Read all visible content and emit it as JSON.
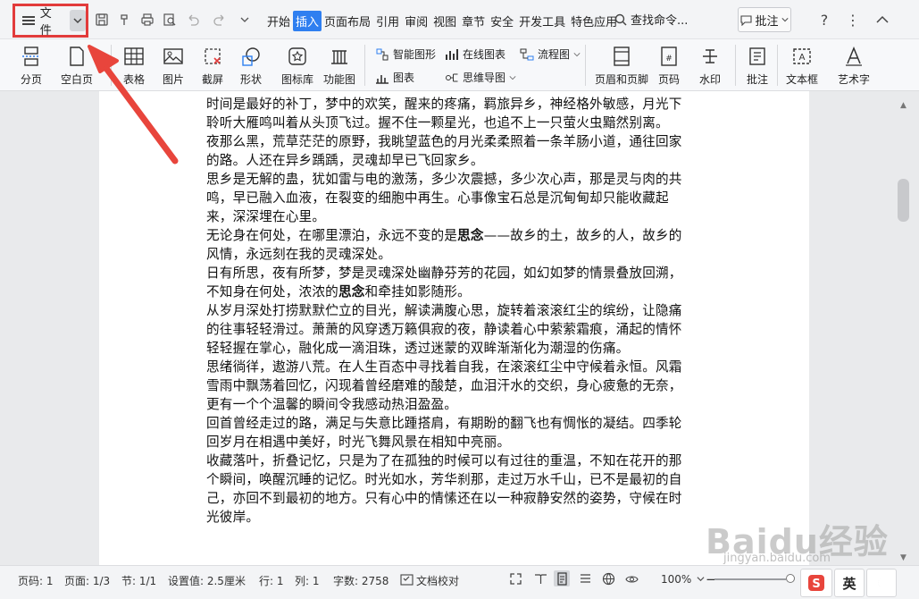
{
  "menubar": {
    "file_label": "文件",
    "tabs": [
      {
        "label": "开始",
        "active": false
      },
      {
        "label": "插入",
        "active": true
      },
      {
        "label": "页面布局",
        "active": false
      },
      {
        "label": "引用",
        "active": false
      },
      {
        "label": "审阅",
        "active": false
      },
      {
        "label": "视图",
        "active": false
      },
      {
        "label": "章节",
        "active": false
      },
      {
        "label": "安全",
        "active": false
      },
      {
        "label": "开发工具",
        "active": false
      },
      {
        "label": "特色应用",
        "active": false
      }
    ],
    "search_label": "查找命令...",
    "annotation_label": "批注"
  },
  "ribbon": {
    "page_break": "分页",
    "blank_page": "空白页",
    "table": "表格",
    "picture": "图片",
    "screenshot": "截屏",
    "shapes": "形状",
    "icon_library": "图标库",
    "function_chart": "功能图",
    "smart_art": "智能图形",
    "online_chart": "在线图表",
    "flowchart": "流程图",
    "chart": "图表",
    "mind_map": "思维导图",
    "header_footer": "页眉和页脚",
    "page_number": "页码",
    "watermark": "水印",
    "comment": "批注",
    "text_box": "文本框",
    "word_art": "艺术字"
  },
  "document": {
    "paragraphs": [
      [
        {
          "t": "时间是最好的补丁，梦中的欢笑，醒来的疼痛，羁旅异乡，神经格外敏感，月光下聆听大雁鸣叫着从头顶飞过。握不住一颗星光，也追不上一只萤火虫黯然别离。"
        }
      ],
      [
        {
          "t": "夜那么黑，荒草茫茫的原野，我眺望蓝色的月光柔柔照着一条羊肠小道，通往回家的路。人还在异乡踽踽，灵魂却早已飞回家乡。"
        }
      ],
      [
        {
          "t": "思乡是无解的蛊，犹如雷与电的激荡，多少次震撼，多少次心声，那是灵与肉的共鸣，早已融入血液，在裂变的细胞中再生。心事像宝石总是沉甸甸却只能收藏起来，深深埋在心里。"
        }
      ],
      [
        {
          "t": "无论身在何处，在哪里漂泊，永远不变的是"
        },
        {
          "t": "思念",
          "b": true
        },
        {
          "t": "——故乡的土，故乡的人，故乡的风情，永远刻在我的灵魂深处。"
        }
      ],
      [
        {
          "t": "日有所思，夜有所梦，梦是灵魂深处幽静芬芳的花园，如幻如梦的情景叠放回溯，不知身在何处，浓浓的"
        },
        {
          "t": "思念",
          "b": true
        },
        {
          "t": "和牵挂如影随形。"
        }
      ],
      [
        {
          "t": "从岁月深处打捞默默伫立的目光，解读满腹心思，旋转着滚滚红尘的缤纷，让隐痛的往事轻轻滑过。萧萧的风穿透万籁俱寂的夜，静读着心中萦萦霜痕，涌起的情怀轻轻握在掌心，融化成一滴泪珠，透过迷蒙的双眸渐渐化为潮湿的伤痛。"
        }
      ],
      [
        {
          "t": "思绪徜徉，遨游八荒。在人生百态中寻找着自我，在滚滚红尘中守候着永恒。风霜雪雨中飘荡着回忆，闪现着曾经磨难的酸楚，血泪汗水的交织，身心疲惫的无奈，更有一个个温馨的瞬间令我感动热泪盈盈。"
        }
      ],
      [
        {
          "t": "回首曾经走过的路，满足与失意比踵搭肩，有期盼的翻飞也有惆怅的凝结。四季轮回岁月在相遇中美好，时光飞舞风景在相知中亮丽。"
        }
      ],
      [
        {
          "t": "收藏落叶，折叠记忆，只是为了在孤独的时候可以有过往的重温，不知在花开的那个瞬间，唤醒沉睡的记忆。时光如水，芳华刹那，走过万水千山，已不是最初的自己，亦回不到最初的地方。只有心中的情愫还在以一种寂静安然的姿势，守候在时光彼岸。"
        }
      ]
    ]
  },
  "statusbar": {
    "page_num": "页码: 1",
    "pages": "页面: 1/3",
    "section": "节: 1/1",
    "setting": "设置值: 2.5厘米",
    "row": "行: 1",
    "col": "列: 1",
    "word_count": "字数: 2758",
    "proofread": "文档校对",
    "zoom": "100%",
    "ime_lang": "英"
  },
  "watermark": {
    "main": "Baidu经验",
    "sub": "jingyan.baidu.com"
  },
  "colors": {
    "accent": "#2f7ff0",
    "highlight_box": "#e23b3b",
    "arrow": "#e8453c"
  }
}
